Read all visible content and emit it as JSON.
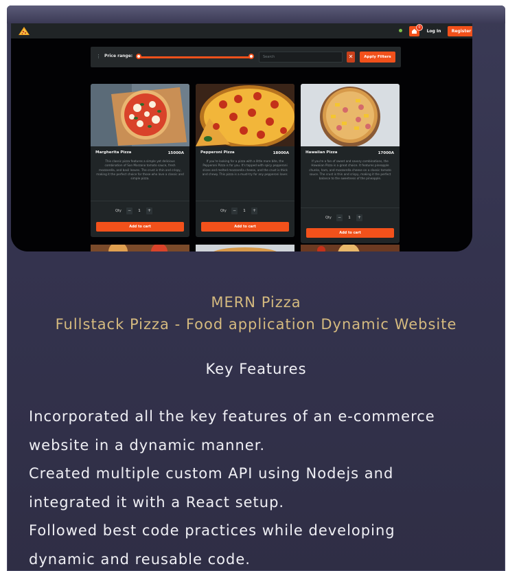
{
  "nav": {
    "login_label": "Log In",
    "register_label": "Register",
    "cart_count": "0"
  },
  "filter": {
    "price_label": "Price range:",
    "search_placeholder": "Search",
    "clear_label": "✕",
    "apply_label": "Apply Filters"
  },
  "products": [
    {
      "name": "Margherita Pizza",
      "price": "15000A",
      "description": "This classic pizza features a simple yet delicious combination of San Marzano tomato sauce, fresh mozzarella, and basil leaves. The crust is thin and crispy, making it the perfect choice for those who love a classic and simple pizza.",
      "qty_label": "Qty",
      "qty": "1",
      "add_label": "Add to cart"
    },
    {
      "name": "Pepperoni Pizza",
      "price": "18000A",
      "description": "If you're looking for a pizza with a little more bite, the Pepperoni Pizza is for you. It's topped with spicy pepperoni slices and melted mozzarella cheese, and the crust is thick and chewy. This pizza is a must-try for any pepperoni lover.",
      "qty_label": "Qty",
      "qty": "1",
      "add_label": "Add to cart"
    },
    {
      "name": "Hawaiian Pizza",
      "price": "17000A",
      "description": "If you're a fan of sweet and savory combinations, the Hawaiian Pizza is a great choice. It features pineapple chunks, ham, and mozzarella cheese on a classic tomato sauce. The crust is thin and crispy, making it the perfect balance to the sweetness of the pineapple.",
      "qty_label": "Qty",
      "qty": "1",
      "add_label": "Add to cart"
    }
  ],
  "caption": {
    "title": "MERN Pizza",
    "subtitle": "Fullstack Pizza - Food application Dynamic Website",
    "key_heading": "Key Features",
    "lines": [
      "Incorporated all the key features of an e-commerce",
      "website in a dynamic manner.",
      "Created multiple custom API using Nodejs and",
      "integrated it with a React setup.",
      "Followed best code practices while developing",
      "dynamic and reusable code."
    ]
  },
  "colors": {
    "accent": "#f2511b",
    "caption_gold": "#d5ba7f",
    "panel_bg": "#34334e"
  },
  "icons": [
    "pizza-logo-icon",
    "cart-icon",
    "filter-icon",
    "close-icon"
  ]
}
